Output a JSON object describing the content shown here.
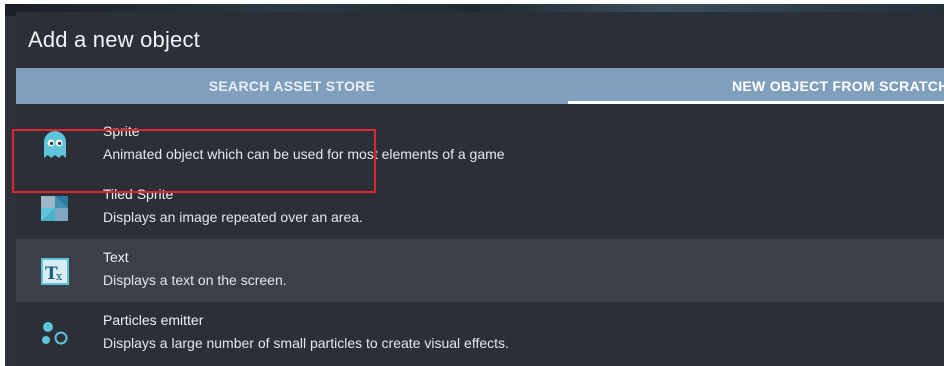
{
  "dialog": {
    "title": "Add a new object"
  },
  "tabs": [
    {
      "label": "SEARCH ASSET STORE"
    },
    {
      "label": "NEW OBJECT FROM SCRATCH"
    }
  ],
  "objects": [
    {
      "name": "Sprite",
      "description": "Animated object which can be used for most elements of a game",
      "icon": "ghost-sprite-icon"
    },
    {
      "name": "Tiled Sprite",
      "description": "Displays an image repeated over an area.",
      "icon": "tiles-icon"
    },
    {
      "name": "Text",
      "description": "Displays a text on the screen.",
      "icon": "text-tx-icon"
    },
    {
      "name": "Particles emitter",
      "description": "Displays a large number of small particles to create visual effects.",
      "icon": "particles-icon"
    }
  ],
  "colors": {
    "dialog_bg": "#2b2f37",
    "tab_bar": "#7f9fbd",
    "highlight": "#e0262c",
    "icon_teal": "#5fc3d9"
  },
  "highlighted_item": "Text"
}
